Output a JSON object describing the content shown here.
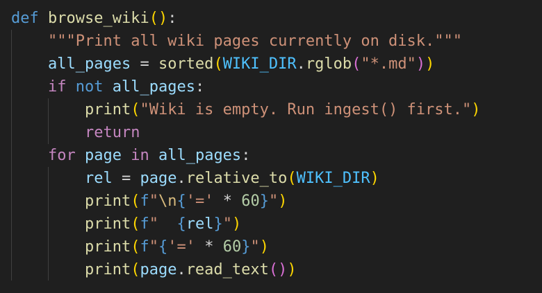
{
  "editor": {
    "colors": {
      "background": "#1f1f1f",
      "keyword_def": "#569cd6",
      "keyword_control": "#c586c0",
      "function": "#dcdcaa",
      "variable": "#9cdcfe",
      "constant": "#4fc1ff",
      "string": "#ce9178",
      "number": "#b5cea8",
      "bracket_level_1": "#ffd700",
      "bracket_level_2": "#da70d6",
      "bracket_level_3": "#179fff"
    },
    "lines": [
      [
        {
          "t": "def",
          "c": "kw-def"
        },
        {
          "t": " ",
          "c": "op"
        },
        {
          "t": "browse_wiki",
          "c": "fn"
        },
        {
          "t": "()",
          "c": "p1"
        },
        {
          "t": ":",
          "c": "op"
        }
      ],
      [
        {
          "t": "    ",
          "c": "op"
        },
        {
          "t": "\"\"\"Print all wiki pages currently on disk.\"\"\"",
          "c": "str"
        }
      ],
      [
        {
          "t": "    ",
          "c": "op"
        },
        {
          "t": "all_pages",
          "c": "var"
        },
        {
          "t": " = ",
          "c": "op"
        },
        {
          "t": "sorted",
          "c": "fn"
        },
        {
          "t": "(",
          "c": "p1"
        },
        {
          "t": "WIKI_DIR",
          "c": "const"
        },
        {
          "t": ".",
          "c": "op"
        },
        {
          "t": "rglob",
          "c": "fn"
        },
        {
          "t": "(",
          "c": "p2"
        },
        {
          "t": "\"*.md\"",
          "c": "str"
        },
        {
          "t": ")",
          "c": "p2"
        },
        {
          "t": ")",
          "c": "p1"
        }
      ],
      [
        {
          "t": "    ",
          "c": "op"
        },
        {
          "t": "if",
          "c": "kw"
        },
        {
          "t": " ",
          "c": "op"
        },
        {
          "t": "not",
          "c": "kw-def"
        },
        {
          "t": " ",
          "c": "op"
        },
        {
          "t": "all_pages",
          "c": "var"
        },
        {
          "t": ":",
          "c": "op"
        }
      ],
      [
        {
          "t": "        ",
          "c": "op"
        },
        {
          "t": "print",
          "c": "fn"
        },
        {
          "t": "(",
          "c": "p1"
        },
        {
          "t": "\"Wiki is empty. Run ingest() first.\"",
          "c": "str"
        },
        {
          "t": ")",
          "c": "p1"
        }
      ],
      [
        {
          "t": "        ",
          "c": "op"
        },
        {
          "t": "return",
          "c": "kw"
        }
      ],
      [
        {
          "t": "    ",
          "c": "op"
        },
        {
          "t": "for",
          "c": "kw"
        },
        {
          "t": " ",
          "c": "op"
        },
        {
          "t": "page",
          "c": "var"
        },
        {
          "t": " ",
          "c": "op"
        },
        {
          "t": "in",
          "c": "kw"
        },
        {
          "t": " ",
          "c": "op"
        },
        {
          "t": "all_pages",
          "c": "var"
        },
        {
          "t": ":",
          "c": "op"
        }
      ],
      [
        {
          "t": "        ",
          "c": "op"
        },
        {
          "t": "rel",
          "c": "var"
        },
        {
          "t": " = ",
          "c": "op"
        },
        {
          "t": "page",
          "c": "var"
        },
        {
          "t": ".",
          "c": "op"
        },
        {
          "t": "relative_to",
          "c": "fn"
        },
        {
          "t": "(",
          "c": "p1"
        },
        {
          "t": "WIKI_DIR",
          "c": "const"
        },
        {
          "t": ")",
          "c": "p1"
        }
      ],
      [
        {
          "t": "        ",
          "c": "op"
        },
        {
          "t": "print",
          "c": "fn"
        },
        {
          "t": "(",
          "c": "p1"
        },
        {
          "t": "f",
          "c": "kw-def"
        },
        {
          "t": "\"",
          "c": "str"
        },
        {
          "t": "\\n",
          "c": "esc"
        },
        {
          "t": "{",
          "c": "kw-def"
        },
        {
          "t": "'='",
          "c": "str"
        },
        {
          "t": " * ",
          "c": "op"
        },
        {
          "t": "60",
          "c": "num"
        },
        {
          "t": "}",
          "c": "kw-def"
        },
        {
          "t": "\"",
          "c": "str"
        },
        {
          "t": ")",
          "c": "p1"
        }
      ],
      [
        {
          "t": "        ",
          "c": "op"
        },
        {
          "t": "print",
          "c": "fn"
        },
        {
          "t": "(",
          "c": "p1"
        },
        {
          "t": "f",
          "c": "kw-def"
        },
        {
          "t": "\"  ",
          "c": "str"
        },
        {
          "t": "{",
          "c": "kw-def"
        },
        {
          "t": "rel",
          "c": "var"
        },
        {
          "t": "}",
          "c": "kw-def"
        },
        {
          "t": "\"",
          "c": "str"
        },
        {
          "t": ")",
          "c": "p1"
        }
      ],
      [
        {
          "t": "        ",
          "c": "op"
        },
        {
          "t": "print",
          "c": "fn"
        },
        {
          "t": "(",
          "c": "p1"
        },
        {
          "t": "f",
          "c": "kw-def"
        },
        {
          "t": "\"",
          "c": "str"
        },
        {
          "t": "{",
          "c": "kw-def"
        },
        {
          "t": "'='",
          "c": "str"
        },
        {
          "t": " * ",
          "c": "op"
        },
        {
          "t": "60",
          "c": "num"
        },
        {
          "t": "}",
          "c": "kw-def"
        },
        {
          "t": "\"",
          "c": "str"
        },
        {
          "t": ")",
          "c": "p1"
        }
      ],
      [
        {
          "t": "        ",
          "c": "op"
        },
        {
          "t": "print",
          "c": "fn"
        },
        {
          "t": "(",
          "c": "p1"
        },
        {
          "t": "page",
          "c": "var"
        },
        {
          "t": ".",
          "c": "op"
        },
        {
          "t": "read_text",
          "c": "fn"
        },
        {
          "t": "()",
          "c": "p2"
        },
        {
          "t": ")",
          "c": "p1"
        }
      ]
    ]
  }
}
